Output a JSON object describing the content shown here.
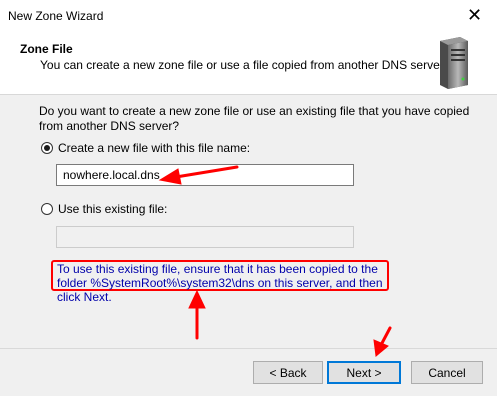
{
  "window": {
    "title": "New Zone Wizard",
    "close_glyph": "✕"
  },
  "header": {
    "title": "Zone File",
    "subtitle": "You can create a new zone file or use a file copied from another DNS server.",
    "icon": "server-icon"
  },
  "body": {
    "question": "Do you want to create a new zone file or use an existing file that you have copied from another DNS server?",
    "option_new": {
      "label": "Create a new file with this file name:",
      "selected": true,
      "value": "nowhere.local.dns"
    },
    "option_existing": {
      "label": "Use this existing file:",
      "selected": false,
      "value": ""
    },
    "note": "To use this existing file, ensure that it has been copied to the folder %SystemRoot%\\system32\\dns on this server, and then click Next."
  },
  "buttons": {
    "back": "< Back",
    "next": "Next >",
    "cancel": "Cancel"
  },
  "colors": {
    "annotation": "#ff0000",
    "note_text": "#0000aa",
    "default_button_border": "#0078d7"
  }
}
